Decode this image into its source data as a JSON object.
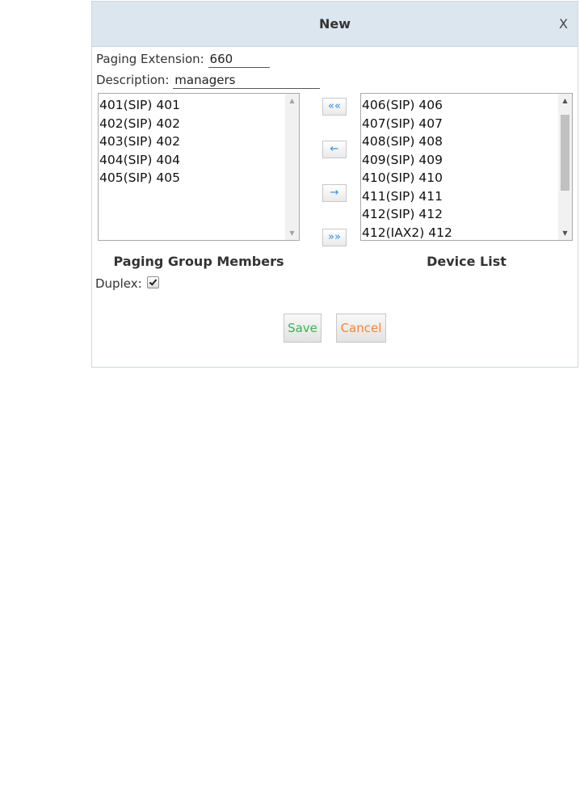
{
  "dialog": {
    "title": "New",
    "close_label": "X"
  },
  "form": {
    "paging_extension_label": "Paging Extension:",
    "paging_extension_value": "660",
    "description_label": "Description:",
    "description_value": "managers"
  },
  "members": {
    "caption": "Paging Group Members",
    "items": [
      "401(SIP) 401",
      "402(SIP) 402",
      "403(SIP) 402",
      "404(SIP) 404",
      "405(SIP) 405"
    ]
  },
  "devices": {
    "caption": "Device List",
    "items": [
      "406(SIP) 406",
      "407(SIP) 407",
      "408(SIP) 408",
      "409(SIP) 409",
      "410(SIP) 410",
      "411(SIP) 411",
      "412(SIP) 412",
      "412(IAX2) 412"
    ]
  },
  "transfer_buttons": {
    "add_all": "««",
    "add_one": "←",
    "remove_one": "→",
    "remove_all": "»»"
  },
  "duplex": {
    "label": "Duplex:",
    "checked": true
  },
  "actions": {
    "save_label": "Save",
    "cancel_label": "Cancel"
  },
  "colors": {
    "titlebar": "#dbe6ef",
    "save_text": "#3fb34f",
    "cancel_text": "#f0883a",
    "arrow_blue": "#2f8fdc"
  }
}
